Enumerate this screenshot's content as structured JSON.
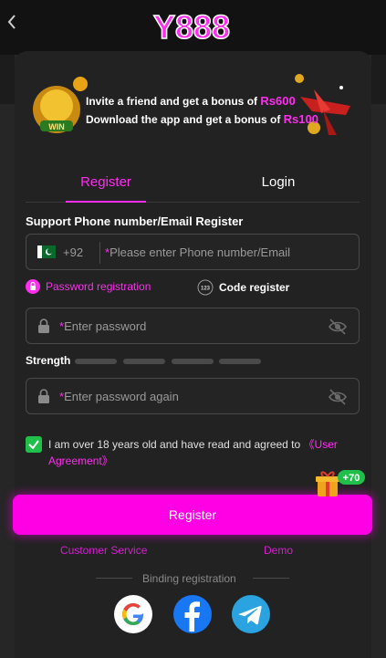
{
  "header": {
    "back_icon": "chevron-left-icon",
    "logo_text": "Y888"
  },
  "banner": {
    "line1_prefix": "Invite a friend and get a bonus of",
    "line1_amount": "Rs600",
    "line2_prefix": "Download the app and get a bonus of",
    "line2_amount": "Rs100",
    "badge_text": "WIN"
  },
  "tabs": [
    {
      "label": "Register",
      "active": true
    },
    {
      "label": "Login",
      "active": false
    }
  ],
  "form": {
    "section_title": "Support Phone number/Email Register",
    "country_code": "+92",
    "phone_placeholder": "Please enter Phone number/Email",
    "password_mode_label": "Password registration",
    "code_mode_label": "Code register",
    "code_icon_text": "123",
    "password_placeholder": "Enter password",
    "strength_label": "Strength",
    "confirm_placeholder": "Enter password again",
    "agree_text": "I am over 18 years old and have read and agreed to",
    "agree_link": "《User Agreement》",
    "gift_badge": "+70",
    "register_button": "Register",
    "required_marker": "*"
  },
  "footer": {
    "customer_service": "Customer Service",
    "demo": "Demo",
    "binding_label": "Binding registration",
    "social": [
      "google-icon",
      "facebook-icon",
      "telegram-icon"
    ]
  },
  "colors": {
    "accent": "#ff00e5",
    "accent_text": "#ff2df0",
    "check_green": "#1fbf4a",
    "background": "#262626"
  }
}
